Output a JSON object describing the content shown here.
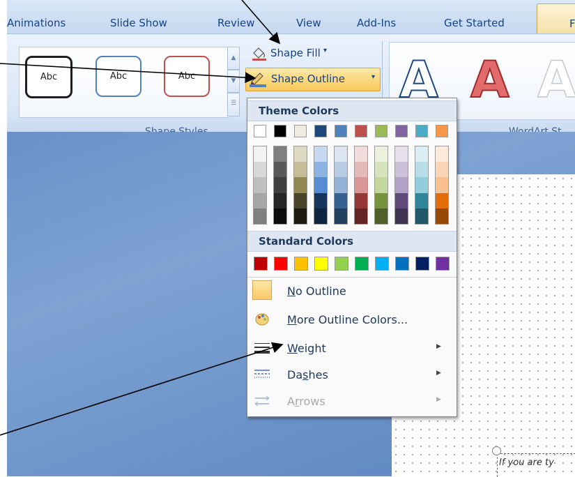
{
  "tabs": [
    "Animations",
    "Slide Show",
    "Review",
    "View",
    "Add-Ins",
    "Get Started"
  ],
  "active_tab": "Fo",
  "gallery": {
    "abc_labels": [
      "Abc",
      "Abc",
      "Abc"
    ],
    "abc_border_colors": [
      "#1f1f1f",
      "#4f81bd",
      "#c0504d"
    ]
  },
  "shape_fill_label": "Shape Fill",
  "shape_outline_label": "Shape Outline",
  "group_labels": {
    "shape_styles": "Shape Styles",
    "wordart": "WordArt St"
  },
  "wordart_letters": [
    "A",
    "A",
    "A"
  ],
  "menu": {
    "theme_colors_header": "Theme Colors",
    "standard_colors_header": "Standard Colors",
    "theme_top_row": [
      "#ffffff",
      "#000000",
      "#eeece1",
      "#1f497d",
      "#4f81bd",
      "#c0504d",
      "#9bbb59",
      "#8064a2",
      "#4bacc6",
      "#f79646"
    ],
    "theme_columns": [
      [
        "#f2f2f2",
        "#d8d8d8",
        "#bfbfbf",
        "#a5a5a5",
        "#7f7f7f"
      ],
      [
        "#7f7f7f",
        "#595959",
        "#3f3f3f",
        "#262626",
        "#0c0c0c"
      ],
      [
        "#ddd9c3",
        "#c4bd97",
        "#938953",
        "#494429",
        "#1d1b10"
      ],
      [
        "#c6d9f0",
        "#8db3e2",
        "#548dd4",
        "#17365d",
        "#0f243e"
      ],
      [
        "#dbe5f1",
        "#b8cce4",
        "#95b3d7",
        "#366092",
        "#244061"
      ],
      [
        "#f2dcdb",
        "#e5b9b7",
        "#d99694",
        "#953734",
        "#632423"
      ],
      [
        "#ebf1dd",
        "#d7e3bc",
        "#c3d69b",
        "#76923c",
        "#4f6128"
      ],
      [
        "#e5e0ec",
        "#ccc1d9",
        "#b2a2c7",
        "#5f497a",
        "#3f3151"
      ],
      [
        "#dbeef3",
        "#b7dde8",
        "#92cddc",
        "#31859b",
        "#205867"
      ],
      [
        "#fdeada",
        "#fbd5b5",
        "#fac08f",
        "#e36c09",
        "#974806"
      ]
    ],
    "standard_row": [
      "#c00000",
      "#ff0000",
      "#ffc000",
      "#ffff00",
      "#92d050",
      "#00b050",
      "#00b0f0",
      "#0070c0",
      "#002060",
      "#7030a0"
    ],
    "items": [
      {
        "label": "No Outline",
        "enabled": true,
        "submenu": false
      },
      {
        "label": "More Outline Colors...",
        "enabled": true,
        "submenu": false
      },
      {
        "label": "Weight",
        "enabled": true,
        "submenu": true
      },
      {
        "label": "Dashes",
        "enabled": true,
        "submenu": true
      },
      {
        "label": "Arrows",
        "enabled": false,
        "submenu": true
      }
    ]
  },
  "slide_text": "If you are ty"
}
